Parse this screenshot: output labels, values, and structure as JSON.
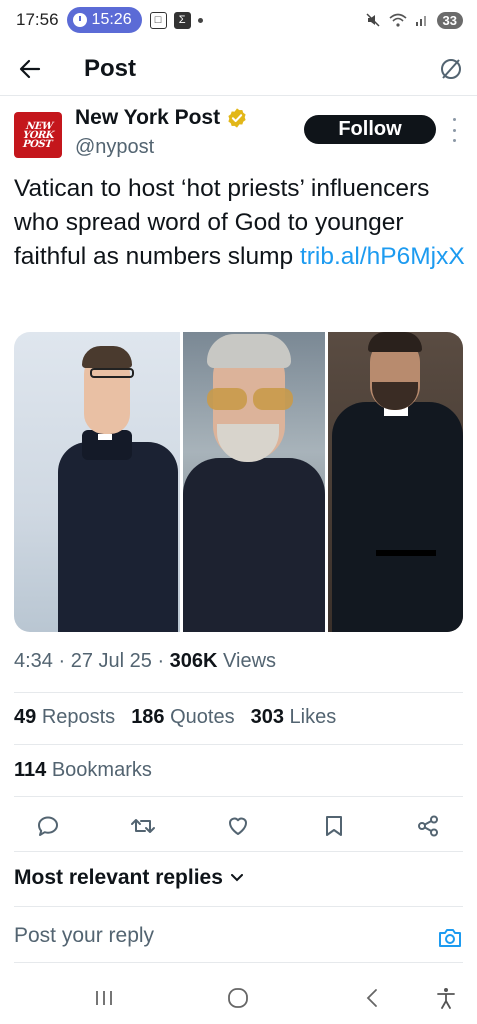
{
  "status_bar": {
    "time": "17:56",
    "timer": "15:26",
    "battery": "33"
  },
  "header": {
    "title": "Post"
  },
  "author": {
    "name": "New York Post",
    "handle": "@nypost",
    "avatar_text": "NEW YORK POST",
    "follow_label": "Follow",
    "verified_color": "#e2b719"
  },
  "post": {
    "text": "Vatican to host ‘hot priests’ influencers who spread word of God to younger faithful as numbers slump ",
    "link": "trib.al/hP6MjxX",
    "link_color": "#1d9bf0"
  },
  "meta": {
    "time": "4:34",
    "date": "27 Jul 25",
    "views_count": "306K",
    "views_label": "Views"
  },
  "stats": {
    "reposts_count": "49",
    "reposts_label": "Reposts",
    "quotes_count": "186",
    "quotes_label": "Quotes",
    "likes_count": "303",
    "likes_label": "Likes",
    "bookmarks_count": "114",
    "bookmarks_label": "Bookmarks"
  },
  "actions": [
    "reply-icon",
    "repost-icon",
    "like-icon",
    "bookmark-icon",
    "share-icon"
  ],
  "replies": {
    "sort_label": "Most relevant replies",
    "input_placeholder": "Post your reply"
  },
  "colors": {
    "text": "#0f1419",
    "secondary": "#536471",
    "accent": "#1d9bf0",
    "timer_pill": "#5b6bd6"
  }
}
